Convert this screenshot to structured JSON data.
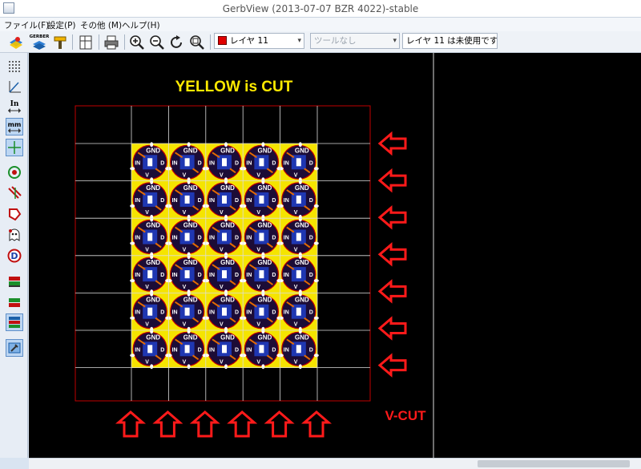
{
  "window": {
    "title": "GerbView (2013-07-07 BZR 4022)-stable"
  },
  "menu": {
    "items": [
      "ファイル(F)",
      "設定(P)",
      "その他 (M)",
      "ヘルプ(H)"
    ]
  },
  "toolbar": {
    "gerber_label": "GERBER",
    "layer_select": "レイヤ 11",
    "layer_color": "#e00000",
    "tool_select": "ツールなし",
    "status": "レイヤ 11 は未使用です",
    "icons": [
      "open-layer-icon",
      "open-gerber-icon",
      "drill-icon",
      "page-icon",
      "print-icon",
      "zoom-in-icon",
      "zoom-out-icon",
      "redraw-icon",
      "zoom-fit-icon"
    ]
  },
  "left_toolbar": {
    "icons": [
      "grid-icon",
      "polar-coords-icon",
      "inch-icon",
      "mm-icon",
      "cursor-icon",
      "flashed-icon",
      "lines-icon",
      "polygon-icon",
      "ghost-icon",
      "dcodes-icon",
      "layers-icon",
      "layers-mode-icon",
      "diff-mode-icon",
      "layer-manager-icon"
    ],
    "inch_label": "In",
    "mm_label": "mm"
  },
  "canvas": {
    "heading": "YELLOW is CUT",
    "vcut_label": "V-CUT",
    "board_label_top": "GND",
    "board_label_left": "IN",
    "board_label_bottom": "V",
    "board_label_right": "D",
    "rows": 6,
    "cols": 5,
    "right_arrows": 7,
    "bottom_arrows": 6,
    "colors": {
      "cut": "#f5e400",
      "arrow": "#ff1a1a",
      "heading": "#ffea00",
      "frame": "#c00000",
      "grid": "#dddddd"
    }
  }
}
